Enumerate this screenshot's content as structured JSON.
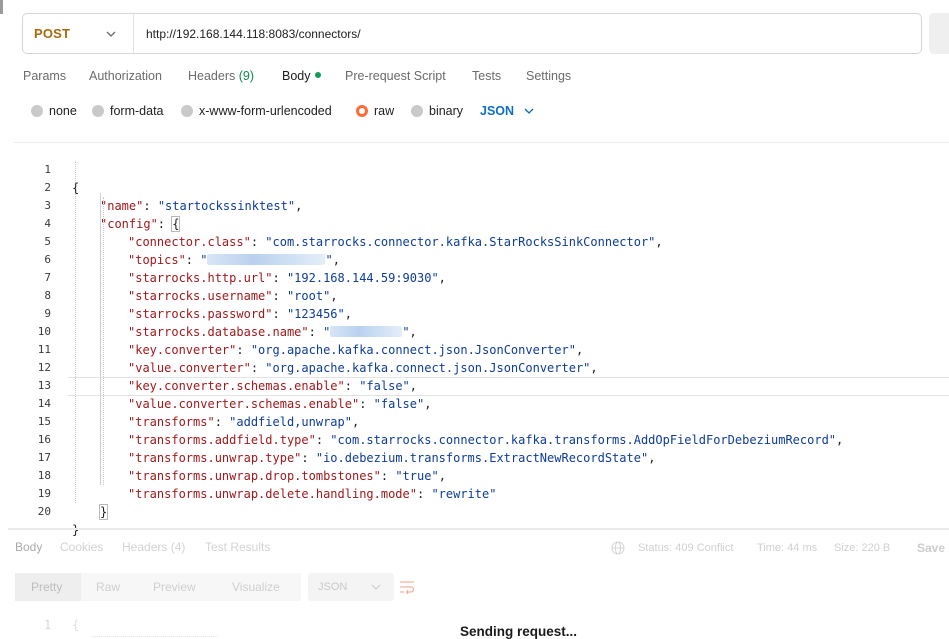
{
  "request": {
    "method": "POST",
    "url": "http://192.168.144.118:8083/connectors/"
  },
  "tabs": [
    {
      "label": "Params"
    },
    {
      "label": "Authorization"
    },
    {
      "label": "Headers",
      "count": "(9)"
    },
    {
      "label": "Body"
    },
    {
      "label": "Pre-request Script"
    },
    {
      "label": "Tests"
    },
    {
      "label": "Settings"
    }
  ],
  "body_modes": {
    "options": [
      "none",
      "form-data",
      "x-www-form-urlencoded",
      "raw",
      "binary"
    ],
    "selected": "raw",
    "language": "JSON"
  },
  "editor": {
    "line_numbers": [
      "1",
      "2",
      "3",
      "4",
      "5",
      "6",
      "7",
      "8",
      "9",
      "10",
      "11",
      "12",
      "13",
      "14",
      "15",
      "16",
      "17",
      "18",
      "19",
      "20"
    ],
    "open_brace": "{",
    "close_brace": "}",
    "name_key": "\"name\"",
    "name_value": "\"startockssinktest\"",
    "config_key": "\"config\"",
    "config_pairs": [
      {
        "key": "\"connector.class\"",
        "value": "\"com.starrocks.connector.kafka.StarRocksSinkConnector\""
      },
      {
        "key": "\"topics\"",
        "value": "",
        "blurred": true
      },
      {
        "key": "\"starrocks.http.url\"",
        "value": "\"192.168.144.59:9030\""
      },
      {
        "key": "\"starrocks.username\"",
        "value": "\"root\""
      },
      {
        "key": "\"starrocks.password\"",
        "value": "\"123456\""
      },
      {
        "key": "\"starrocks.database.name\"",
        "value": "",
        "blurred": true
      },
      {
        "key": "\"key.converter\"",
        "value": "\"org.apache.kafka.connect.json.JsonConverter\""
      },
      {
        "key": "\"value.converter\"",
        "value": "\"org.apache.kafka.connect.json.JsonConverter\""
      },
      {
        "key": "\"key.converter.schemas.enable\"",
        "value": "\"false\""
      },
      {
        "key": "\"value.converter.schemas.enable\"",
        "value": "\"false\""
      },
      {
        "key": "\"transforms\"",
        "value": "\"addfield,unwrap\""
      },
      {
        "key": "\"transforms.addfield.type\"",
        "value": "\"com.starrocks.connector.kafka.transforms.AddOpFieldForDebeziumRecord\""
      },
      {
        "key": "\"transforms.unwrap.type\"",
        "value": "\"io.debezium.transforms.ExtractNewRecordState\""
      },
      {
        "key": "\"transforms.unwrap.drop.tombstones\"",
        "value": "\"true\""
      },
      {
        "key": "\"transforms.unwrap.delete.handling.mode\"",
        "value": "\"rewrite\""
      }
    ]
  },
  "response": {
    "tabs": [
      "Body",
      "Cookies",
      "Headers",
      "Test Results"
    ],
    "headers_count": "(4)",
    "status": "Status: 409 Conflict",
    "time": "Time: 44 ms",
    "size": "Size: 220 B",
    "save_label": "Save",
    "view_modes": [
      "Pretty",
      "Raw",
      "Preview",
      "Visualize"
    ],
    "format": "JSON",
    "ghost_line_number": "1",
    "ghost_brace": "{",
    "sending_text": "Sending request..."
  },
  "colors": {
    "method": "#a9690d",
    "json_key": "#a1191c",
    "json_string": "#0d3c99",
    "language": "#0d6ec5",
    "radio_selected": "#ff6c37",
    "body_dot": "#0f9d58"
  }
}
